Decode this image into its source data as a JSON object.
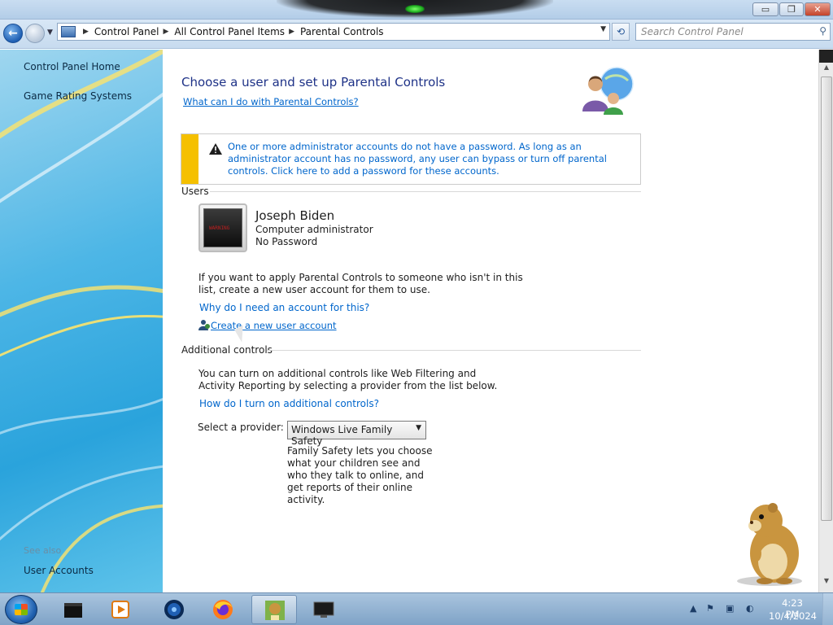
{
  "window": {
    "minimize_glyph": "▭",
    "maximize_glyph": "❐",
    "close_glyph": "✕"
  },
  "address": {
    "crumbs": [
      "Control Panel",
      "All Control Panel Items",
      "Parental Controls"
    ],
    "search_placeholder": "Search Control Panel"
  },
  "sidebar": {
    "items": [
      "Control Panel Home",
      "Game Rating Systems"
    ],
    "see_also_label": "See also",
    "see_also_items": [
      "User Accounts"
    ]
  },
  "main": {
    "title": "Choose a user and set up Parental Controls",
    "help_link": "What can I do with Parental Controls?",
    "warning": "One or more administrator accounts do not have a password. As long as an administrator account has no password, any user can bypass or turn off parental controls. Click here to add a password for these accounts.",
    "users_section": "Users",
    "user": {
      "name": "Joseph Biden",
      "role": "Computer administrator",
      "password_status": "No Password",
      "tile_text": "WARNING"
    },
    "users_para": "If you want to apply Parental Controls to someone who isn't in this list, create a new user account for them to use.",
    "why_link": "Why do I need an account for this?",
    "create_link": "Create a new user account",
    "additional_section": "Additional controls",
    "additional_para": "You can turn on additional controls like Web Filtering and Activity Reporting by selecting a provider from the list below.",
    "how_link": "How do I turn on additional controls?",
    "provider_label": "Select a provider:",
    "provider_value": "Windows Live Family Safety",
    "provider_desc": "Family Safety lets you choose what your children see and who they talk to online, and get reports of their online activity."
  },
  "taskbar": {
    "apps": [
      "black-box-app-icon",
      "media-player-icon",
      "globe-app-icon",
      "firefox-icon",
      "hamster-box-icon",
      "monitor-app-icon"
    ],
    "active_app_index": 4,
    "time": "4:23 PM",
    "date": "10/4/2024"
  },
  "colors": {
    "link": "#0066cc",
    "title": "#1e3287",
    "warning_stripe": "#f5c000"
  }
}
